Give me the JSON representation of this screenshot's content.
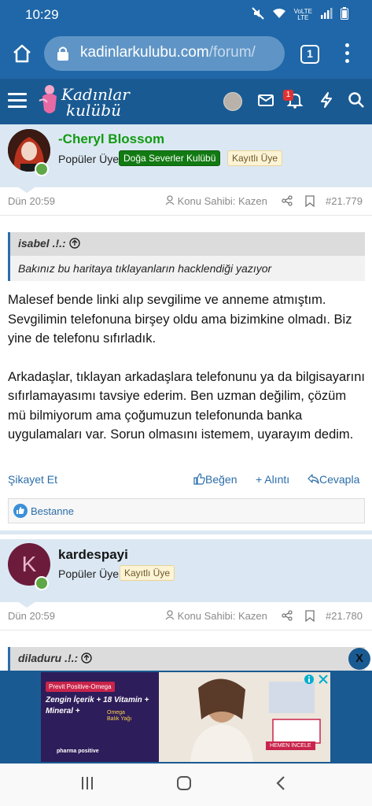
{
  "status": {
    "time": "10:29",
    "network": "VoLTE",
    "lte": "LTE"
  },
  "browser": {
    "url_main": "kadinlarkulubu.com",
    "url_path": "/forum/",
    "tab_count": "1"
  },
  "site": {
    "logo_line1": "Kadınlar",
    "logo_line2": "kulübü",
    "notification_count": "1"
  },
  "posts": [
    {
      "username": "-Cheryl Blossom",
      "username_color": "#129a12",
      "user_title": "Popüler Üye",
      "badges": [
        "Doğa Severler Kulübü",
        "Kayıtlı Üye"
      ],
      "date": "Dün 20:59",
      "owner_label": "Konu Sahibi: Kazen",
      "post_number": "#21.779",
      "quote_author": "isabel .!.:",
      "quote_text": "Bakınız bu haritaya tıklayanların hacklendiği yazıyor",
      "paragraph1": "Malesef bende linki alıp sevgilime ve anneme atmıştım. Sevgilimin telefonuna birşey oldu ama bizimkine olmadı. Biz yine de telefonu sıfırladık.",
      "paragraph2": "Arkadaşlar, tıklayan arkadaşlara telefonunu ya da bilgisayarını sıfırlamayasımı tavsiye ederim. Ben uzman değilim, çözüm mü bilmiyorum ama çoğumuzun telefonunda banka uygulamaları var. Sorun olmasını istemem, uyarayım dedim.",
      "report_label": "Şikayet Et",
      "like_label": "Beğen",
      "quote_label": "+ Alıntı",
      "reply_label": "Cevapla",
      "reaction_user": "Bestanne"
    },
    {
      "username": "kardespayi",
      "user_title": "Popüler Üye",
      "badges": [
        "Kayıtlı Üye"
      ],
      "avatar_letter": "K",
      "avatar_color": "#6d1b3b",
      "date": "Dün 20:59",
      "owner_label": "Konu Sahibi: Kazen",
      "post_number": "#21.780",
      "quote_author": "diladuru .!.:"
    }
  ],
  "ad": {
    "brand": "Previt Positive-Omega",
    "headline1": "Zengin İçerik + 18 Vitamin +",
    "headline2": "Mineral +",
    "omega": "Omega Balık Yağı",
    "cta": "HEMEN İNCELE",
    "footer": "pharma positive",
    "close_label": "X"
  },
  "colors": {
    "primary": "#1f67a8",
    "header": "#1a5a92",
    "link": "#2b6da8",
    "user_bg": "#dbe8f3"
  }
}
